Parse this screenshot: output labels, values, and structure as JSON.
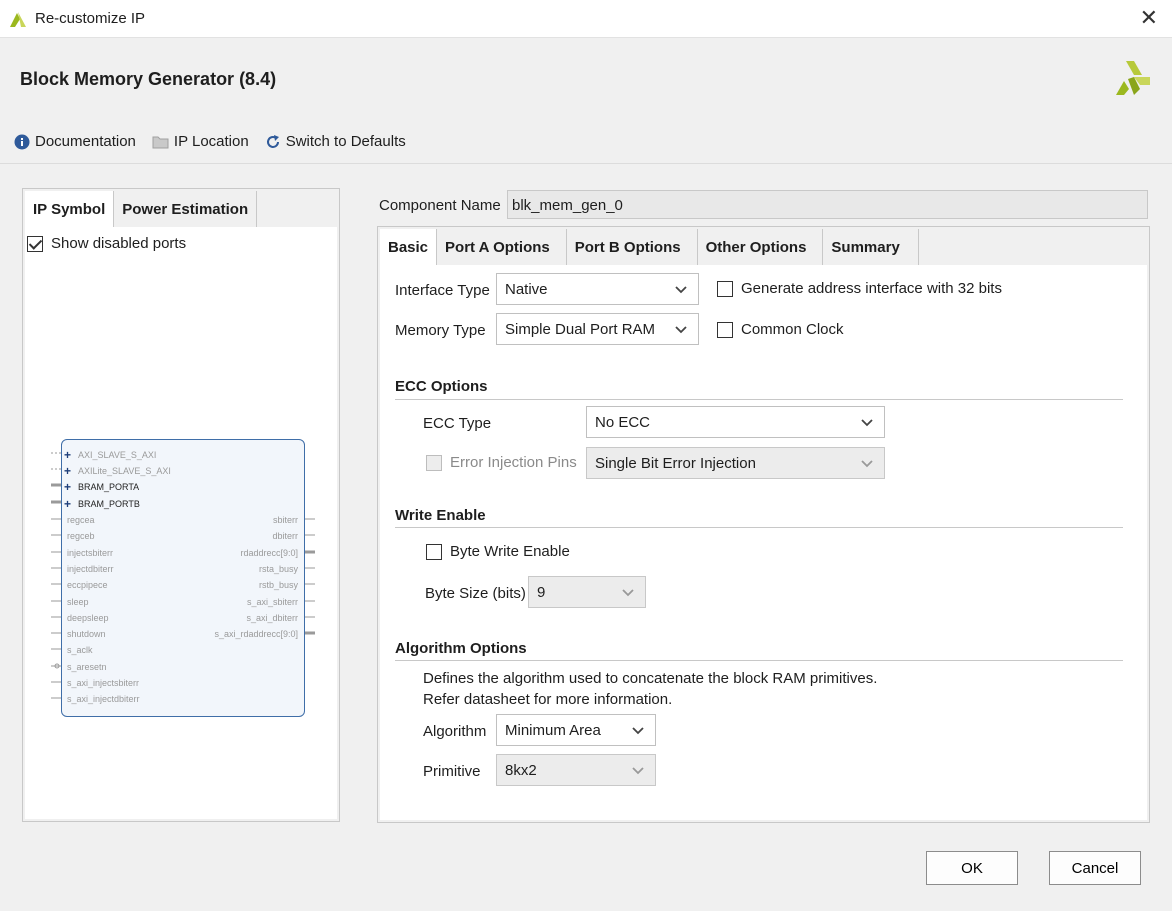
{
  "window": {
    "title": "Re-customize IP"
  },
  "header": {
    "heading": "Block Memory Generator (8.4)"
  },
  "toolbar": {
    "documentation": "Documentation",
    "ip_location": "IP Location",
    "switch_defaults": "Switch to Defaults"
  },
  "left_tabs": [
    "IP Symbol",
    "Power Estimation"
  ],
  "show_disabled_ports": {
    "label": "Show disabled ports",
    "checked": true
  },
  "symbol": {
    "left_ports": [
      "AXI_SLAVE_S_AXI",
      "AXILite_SLAVE_S_AXI",
      "BRAM_PORTA",
      "BRAM_PORTB",
      "regcea",
      "regceb",
      "injectsbiterr",
      "injectdbiterr",
      "eccpipece",
      "sleep",
      "deepsleep",
      "shutdown",
      "s_aclk",
      "s_aresetn",
      "s_axi_injectsbiterr",
      "s_axi_injectdbiterr"
    ],
    "right_ports": [
      "sbiterr",
      "dbiterr",
      "rdaddrecc[9:0]",
      "rsta_busy",
      "rstb_busy",
      "s_axi_sbiterr",
      "s_axi_dbiterr",
      "s_axi_rdaddrecc[9:0]"
    ]
  },
  "component": {
    "label": "Component Name",
    "value": "blk_mem_gen_0"
  },
  "tabs": [
    "Basic",
    "Port A Options",
    "Port B Options",
    "Other Options",
    "Summary"
  ],
  "basic": {
    "interface_type": {
      "label": "Interface Type",
      "value": "Native"
    },
    "memory_type": {
      "label": "Memory Type",
      "value": "Simple Dual Port RAM"
    },
    "gen_addr_32": {
      "label": "Generate address interface with 32 bits",
      "checked": false
    },
    "common_clock": {
      "label": "Common Clock",
      "checked": false
    },
    "ecc_section": "ECC Options",
    "ecc_type": {
      "label": "ECC Type",
      "value": "No ECC"
    },
    "error_injection": {
      "label": "Error Injection Pins",
      "value": "Single Bit Error Injection"
    },
    "write_section": "Write Enable",
    "byte_write_enable": {
      "label": "Byte Write Enable",
      "checked": false
    },
    "byte_size": {
      "label": "Byte Size (bits)",
      "value": "9"
    },
    "algo_section": "Algorithm Options",
    "algo_desc1": "Defines the algorithm used to concatenate the block RAM primitives.",
    "algo_desc2": "Refer datasheet for more information.",
    "algorithm": {
      "label": "Algorithm",
      "value": "Minimum Area"
    },
    "primitive": {
      "label": "Primitive",
      "value": "8kx2"
    }
  },
  "buttons": {
    "ok": "OK",
    "cancel": "Cancel"
  },
  "colors": {
    "accent": "#3f6ea8",
    "logo_green": "#9bb81f"
  }
}
